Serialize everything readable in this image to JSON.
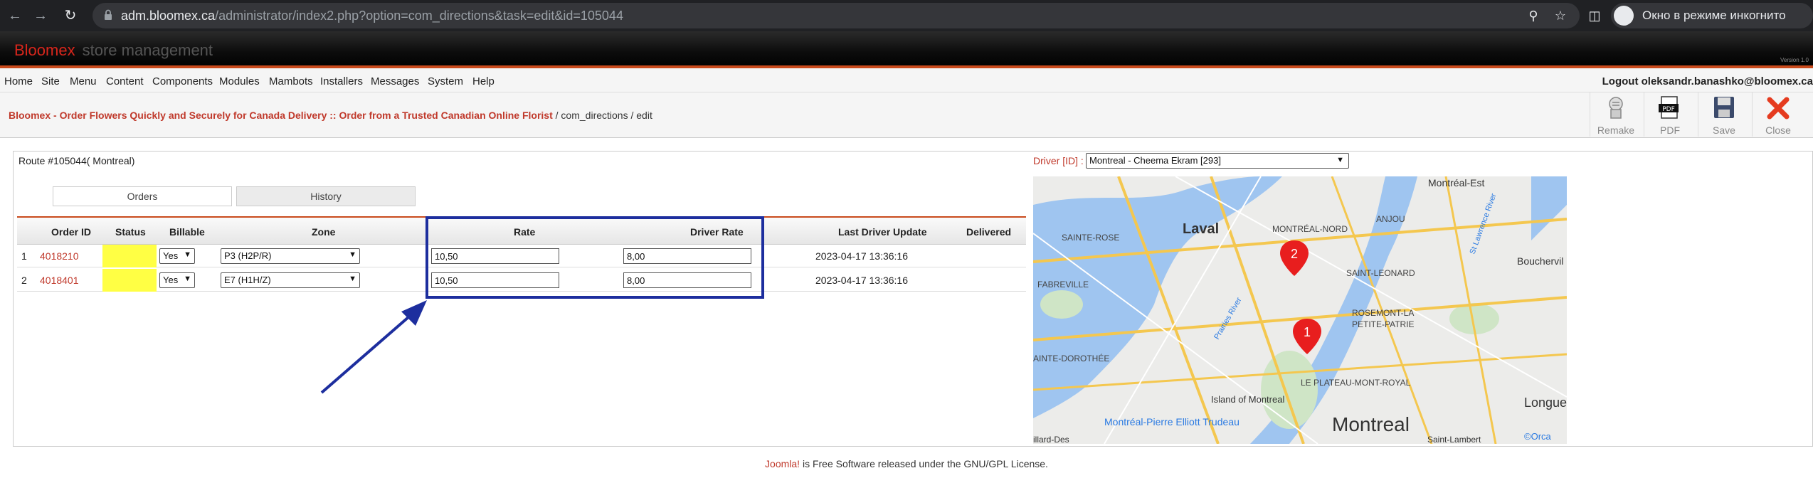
{
  "browser": {
    "url_host": "adm.bloomex.ca",
    "url_path": "/administrator/index2.php?option=com_directions&task=edit&id=105044",
    "incognito_label": "Окно в режиме инкогнито"
  },
  "header": {
    "brand_red": "Bloomex",
    "brand_grey": "store management",
    "version": "Version 1.0"
  },
  "menu": {
    "items": [
      "Home",
      "Site",
      "Menu",
      "Content",
      "Components",
      "Modules",
      "Mambots",
      "Installers",
      "Messages",
      "System",
      "Help"
    ],
    "logout": "Logout oleksandr.banashko@bloomex.ca"
  },
  "breadcrumb": {
    "site": "Bloomex - Order Flowers Quickly and Securely for Canada Delivery :: Order from a Trusted Canadian Online Florist",
    "rest": " / com_directions / edit"
  },
  "toolbar": {
    "remake": "Remake",
    "pdf": "PDF",
    "save": "Save",
    "close": "Close"
  },
  "route": {
    "title": "Route #105044( Montreal)"
  },
  "tabs": {
    "orders": "Orders",
    "history": "History"
  },
  "table": {
    "headers": {
      "order_id": "Order ID",
      "status": "Status",
      "billable": "Billable",
      "zone": "Zone",
      "rate": "Rate",
      "driver_rate": "Driver Rate",
      "last_update": "Last Driver Update",
      "delivered": "Delivered"
    },
    "rows": [
      {
        "num": "1",
        "order_id": "4018210",
        "billable": "Yes",
        "zone": "P3 (H2P/R)",
        "rate": "10,50",
        "driver_rate": "8,00",
        "last_update": "2023-04-17 13:36:16"
      },
      {
        "num": "2",
        "order_id": "4018401",
        "billable": "Yes",
        "zone": "E7 (H1H/Z)",
        "rate": "10,50",
        "driver_rate": "8,00",
        "last_update": "2023-04-17 13:36:16"
      }
    ]
  },
  "driver": {
    "label": "Driver [ID] :",
    "selected": "Montreal - Cheema Ekram [293]"
  },
  "map": {
    "labels": {
      "laval": "Laval",
      "montreal_est": "Montréal-Est",
      "sainte_rose": "SAINTE-ROSE",
      "montreal_nord": "MONTRÉAL-NORD",
      "anjou": "ANJOU",
      "boucherville": "Bouchervil",
      "fabreville": "FABREVILLE",
      "saint_leonard": "SAINT-LEONARD",
      "rosemont": "ROSEMONT-LA",
      "petite_patrie": "PETITE-PATRIE",
      "sainte_dorothee": "AINTE-DOROTHÉE",
      "plateau": "LE PLATEAU-MONT-ROYAL",
      "island": "Island of Montreal",
      "longue": "Longue",
      "airport": "Montréal-Pierre Elliott Trudeau",
      "montreal": "Montreal",
      "lambert": "Saint-Lambert",
      "prairies": "Prairies River",
      "lawrence": "St Lawrence River",
      "villard": "illard-Des",
      "attribution": "©Orca"
    },
    "markers": [
      "1",
      "2"
    ]
  },
  "footer": {
    "joomla": "Joomla!",
    "text": " is Free Software released under the GNU/GPL License."
  },
  "colors": {
    "brand_red": "#d9261c",
    "link_red": "#c0392b",
    "status_yellow": "#ffff44",
    "annotation_blue": "#1d2e9e"
  }
}
